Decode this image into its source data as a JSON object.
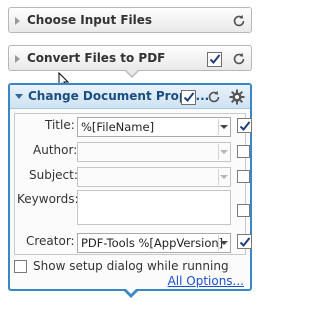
{
  "panels": [
    {
      "title": "Choose Input Files"
    },
    {
      "title": "Convert Files to PDF"
    },
    {
      "title": "Change Document Prope..."
    }
  ],
  "fields": {
    "title": {
      "label": "Title:",
      "value": "%[FileName]"
    },
    "author": {
      "label": "Author:",
      "value": ""
    },
    "subject": {
      "label": "Subject:",
      "value": ""
    },
    "keywords": {
      "label": "Keywords:",
      "value": ""
    },
    "creator": {
      "label": "Creator:",
      "value": "PDF-Tools %[AppVersion]"
    }
  },
  "footer": {
    "show_setup_label": "Show setup dialog while running",
    "all_options_link": "All Options..."
  },
  "colors": {
    "accent": "#3b86c4",
    "link": "#1c4fd0"
  },
  "icons": [
    "expand-arrow-icon",
    "reset-icon",
    "checkmark-icon",
    "gear-icon",
    "mouse-cursor-icon"
  ]
}
